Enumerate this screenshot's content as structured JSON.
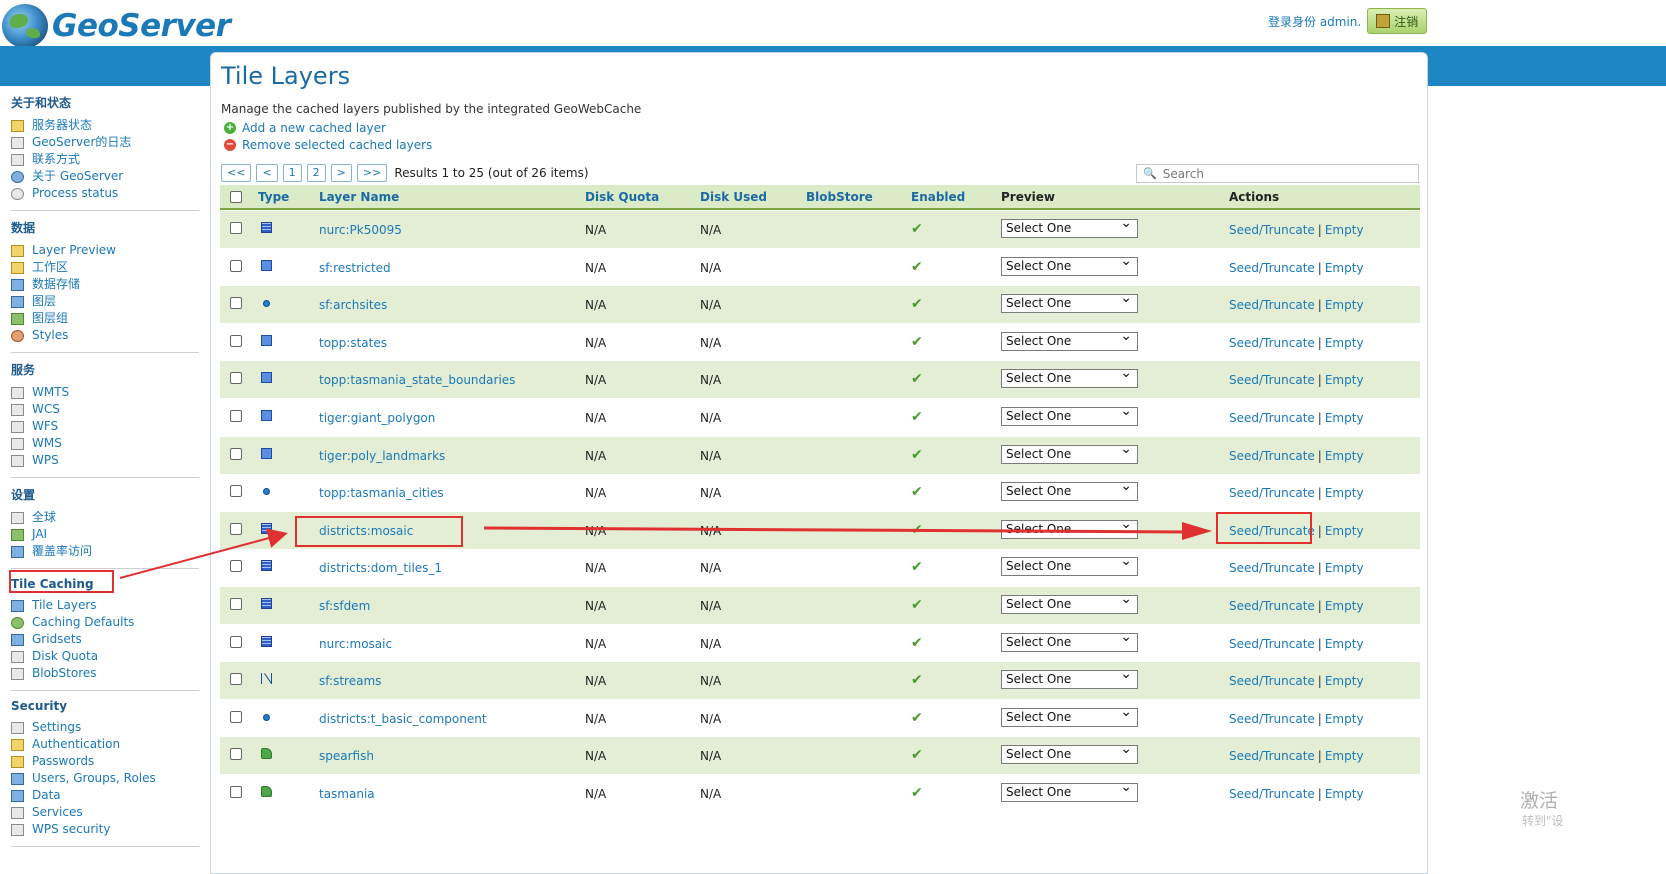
{
  "app": {
    "brand": "GeoServer",
    "user_label": "登录身份 admin.",
    "logout_label": "注销"
  },
  "sidebar": {
    "sections": [
      {
        "title": "关于和状态",
        "items": [
          {
            "label": "服务器状态",
            "icon": "server-status-icon"
          },
          {
            "label": "GeoServer的日志",
            "icon": "log-icon"
          },
          {
            "label": "联系方式",
            "icon": "contact-icon"
          },
          {
            "label": "关于 GeoServer",
            "icon": "about-icon"
          },
          {
            "label": "Process status",
            "icon": "process-icon"
          }
        ]
      },
      {
        "title": "数据",
        "items": [
          {
            "label": "Layer Preview",
            "icon": "layer-preview-icon"
          },
          {
            "label": "工作区",
            "icon": "workspace-icon"
          },
          {
            "label": "数据存储",
            "icon": "store-icon"
          },
          {
            "label": "图层",
            "icon": "layer-icon"
          },
          {
            "label": "图层组",
            "icon": "layergroup-icon"
          },
          {
            "label": "Styles",
            "icon": "styles-icon"
          }
        ]
      },
      {
        "title": "服务",
        "items": [
          {
            "label": "WMTS",
            "icon": "service-icon"
          },
          {
            "label": "WCS",
            "icon": "service-icon"
          },
          {
            "label": "WFS",
            "icon": "service-icon"
          },
          {
            "label": "WMS",
            "icon": "service-icon"
          },
          {
            "label": "WPS",
            "icon": "service-icon"
          }
        ]
      },
      {
        "title": "设置",
        "items": [
          {
            "label": "全球",
            "icon": "global-icon"
          },
          {
            "label": "JAI",
            "icon": "jai-icon"
          },
          {
            "label": "覆盖率访问",
            "icon": "coverage-icon"
          }
        ]
      },
      {
        "title": "Tile Caching",
        "items": [
          {
            "label": "Tile Layers",
            "icon": "tile-layers-icon"
          },
          {
            "label": "Caching Defaults",
            "icon": "caching-icon"
          },
          {
            "label": "Gridsets",
            "icon": "gridsets-icon"
          },
          {
            "label": "Disk Quota",
            "icon": "disk-icon"
          },
          {
            "label": "BlobStores",
            "icon": "blobstore-icon"
          }
        ]
      },
      {
        "title": "Security",
        "items": [
          {
            "label": "Settings",
            "icon": "settings-icon"
          },
          {
            "label": "Authentication",
            "icon": "auth-icon"
          },
          {
            "label": "Passwords",
            "icon": "lock-icon"
          },
          {
            "label": "Users, Groups, Roles",
            "icon": "users-icon"
          },
          {
            "label": "Data",
            "icon": "data-icon"
          },
          {
            "label": "Services",
            "icon": "services-icon"
          },
          {
            "label": "WPS security",
            "icon": "wps-security-icon"
          }
        ]
      }
    ]
  },
  "page": {
    "title": "Tile Layers",
    "description": "Manage the cached layers published by the integrated GeoWebCache",
    "add_label": "Add a new cached layer",
    "remove_label": "Remove selected cached layers",
    "pager": [
      "<<",
      "<",
      "1",
      "2",
      ">",
      ">>"
    ],
    "results": "Results 1 to 25 (out of 26 items)",
    "search_placeholder": "Search"
  },
  "table": {
    "headers": [
      "Type",
      "Layer Name",
      "Disk Quota",
      "Disk Used",
      "BlobStore",
      "Enabled",
      "Preview",
      "Actions"
    ],
    "preview_default": "Select One",
    "seed_label": "Seed/Truncate",
    "empty_label": "Empty",
    "rows": [
      {
        "type": "raster",
        "name": "nurc:Pk50095",
        "quota": "N/A",
        "used": "N/A"
      },
      {
        "type": "polygon",
        "name": "sf:restricted",
        "quota": "N/A",
        "used": "N/A"
      },
      {
        "type": "point",
        "name": "sf:archsites",
        "quota": "N/A",
        "used": "N/A"
      },
      {
        "type": "polygon",
        "name": "topp:states",
        "quota": "N/A",
        "used": "N/A"
      },
      {
        "type": "polygon",
        "name": "topp:tasmania_state_boundaries",
        "quota": "N/A",
        "used": "N/A"
      },
      {
        "type": "polygon",
        "name": "tiger:giant_polygon",
        "quota": "N/A",
        "used": "N/A"
      },
      {
        "type": "polygon",
        "name": "tiger:poly_landmarks",
        "quota": "N/A",
        "used": "N/A"
      },
      {
        "type": "point",
        "name": "topp:tasmania_cities",
        "quota": "N/A",
        "used": "N/A"
      },
      {
        "type": "raster",
        "name": "districts:mosaic",
        "quota": "N/A",
        "used": "N/A"
      },
      {
        "type": "raster",
        "name": "districts:dom_tiles_1",
        "quota": "N/A",
        "used": "N/A"
      },
      {
        "type": "raster",
        "name": "sf:sfdem",
        "quota": "N/A",
        "used": "N/A"
      },
      {
        "type": "raster",
        "name": "nurc:mosaic",
        "quota": "N/A",
        "used": "N/A"
      },
      {
        "type": "line",
        "name": "sf:streams",
        "quota": "N/A",
        "used": "N/A"
      },
      {
        "type": "point",
        "name": "districts:t_basic_component",
        "quota": "N/A",
        "used": "N/A"
      },
      {
        "type": "group",
        "name": "spearfish",
        "quota": "N/A",
        "used": "N/A"
      },
      {
        "type": "group",
        "name": "tasmania",
        "quota": "N/A",
        "used": "N/A"
      }
    ]
  },
  "overlay": {
    "watermark": "激活",
    "watermark2": "转到\"设"
  }
}
